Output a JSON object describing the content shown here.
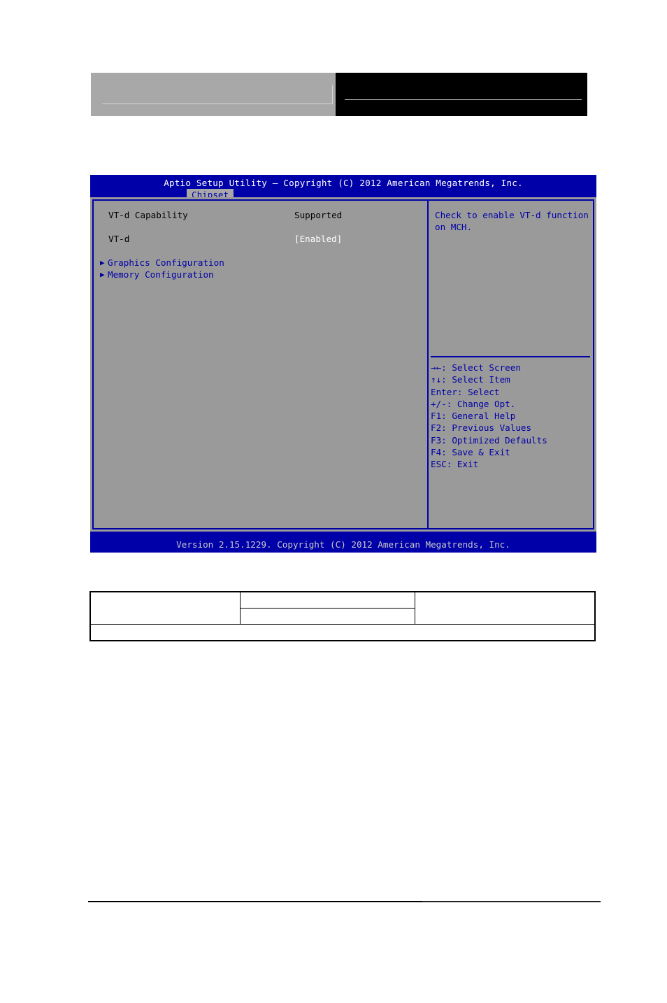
{
  "header": {
    "left_block": "",
    "right_block": ""
  },
  "bios": {
    "title": "Aptio Setup Utility – Copyright (C) 2012 American Megatrends, Inc.",
    "tab": "Chipset",
    "settings": [
      {
        "label": "VT-d Capability",
        "value": "Supported",
        "value_style": "black"
      },
      {
        "label": "VT-d",
        "value": "[Enabled]",
        "value_style": "white"
      }
    ],
    "submenus": [
      {
        "arrow": "▶",
        "label": "Graphics Configuration"
      },
      {
        "arrow": "▶",
        "label": "Memory Configuration"
      }
    ],
    "help": [
      "Check to enable VT-d function",
      "on MCH."
    ],
    "legend": [
      "→←: Select Screen",
      "↑↓: Select Item",
      "Enter: Select",
      "+/-: Change Opt.",
      "F1: General Help",
      "F2: Previous Values",
      "F3: Optimized Defaults",
      "F4: Save & Exit",
      "ESC: Exit"
    ],
    "footer": "Version 2.15.1229. Copyright (C) 2012 American Megatrends, Inc."
  },
  "bottom_table": {
    "row1": [
      "",
      "",
      ""
    ],
    "row2": [
      "",
      ""
    ],
    "row3": [
      ""
    ]
  },
  "colors": {
    "bios_blue": "#0000a8",
    "bios_gray": "#9a9a9a",
    "tab_gray": "#a8a8a8",
    "footer_text": "#c8c8c8"
  }
}
